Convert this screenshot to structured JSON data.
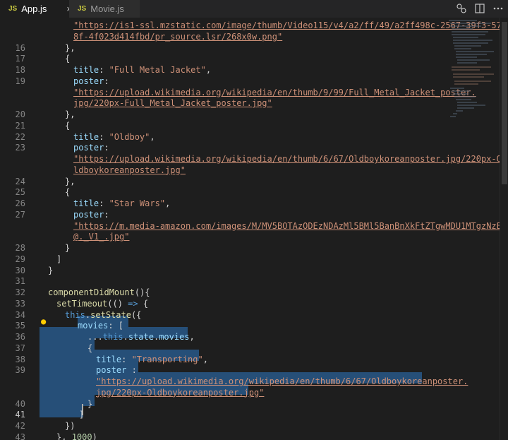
{
  "tabs": [
    {
      "icon": "JS",
      "label": "App.js",
      "close": "×"
    },
    {
      "icon": "JS",
      "label": "Movie.js"
    }
  ],
  "lines": [
    {
      "num": "",
      "segments": [
        {
          "t": "\"https://is1-ssl.mzstatic.com/image/thumb/Video115/v4/a2/ff/49/a2ff498c-2567-39f3-57",
          "c": "su"
        }
      ]
    },
    {
      "num": "",
      "segments": [
        {
          "t": "8f-4f023d414fbd/pr_source.lsr/268x0w.png\"",
          "c": "su"
        }
      ]
    },
    {
      "num": "16",
      "segments": [
        {
          "t": "},",
          "c": "p"
        }
      ]
    },
    {
      "num": "17",
      "segments": [
        {
          "t": "{",
          "c": "p"
        }
      ]
    },
    {
      "num": "18",
      "segments": [
        {
          "t": "title",
          "c": "pr"
        },
        {
          "t": ": ",
          "c": "p"
        },
        {
          "t": "\"Full Metal Jacket\"",
          "c": "s"
        },
        {
          "t": ",",
          "c": "p"
        }
      ]
    },
    {
      "num": "19",
      "segments": [
        {
          "t": "poster",
          "c": "pr"
        },
        {
          "t": ":",
          "c": "p"
        }
      ]
    },
    {
      "num": "",
      "segments": [
        {
          "t": "\"https://upload.wikimedia.org/wikipedia/en/thumb/9/99/Full_Metal_Jacket_poster.",
          "c": "su"
        }
      ]
    },
    {
      "num": "",
      "segments": [
        {
          "t": "jpg/220px-Full_Metal_Jacket_poster.jpg\"",
          "c": "su"
        }
      ]
    },
    {
      "num": "20",
      "segments": [
        {
          "t": "},",
          "c": "p"
        }
      ]
    },
    {
      "num": "21",
      "segments": [
        {
          "t": "{",
          "c": "p"
        }
      ]
    },
    {
      "num": "22",
      "segments": [
        {
          "t": "title",
          "c": "pr"
        },
        {
          "t": ": ",
          "c": "p"
        },
        {
          "t": "\"Oldboy\"",
          "c": "s"
        },
        {
          "t": ",",
          "c": "p"
        }
      ]
    },
    {
      "num": "23",
      "segments": [
        {
          "t": "poster",
          "c": "pr"
        },
        {
          "t": ":",
          "c": "p"
        }
      ]
    },
    {
      "num": "",
      "segments": [
        {
          "t": "\"https://upload.wikimedia.org/wikipedia/en/thumb/6/67/Oldboykoreanposter.jpg/220px-O",
          "c": "su"
        }
      ]
    },
    {
      "num": "",
      "segments": [
        {
          "t": "ldboykoreanposter.jpg\"",
          "c": "su"
        }
      ]
    },
    {
      "num": "24",
      "segments": [
        {
          "t": "},",
          "c": "p"
        }
      ]
    },
    {
      "num": "25",
      "segments": [
        {
          "t": "{",
          "c": "p"
        }
      ]
    },
    {
      "num": "26",
      "segments": [
        {
          "t": "title",
          "c": "pr"
        },
        {
          "t": ": ",
          "c": "p"
        },
        {
          "t": "\"Star Wars\"",
          "c": "s"
        },
        {
          "t": ",",
          "c": "p"
        }
      ]
    },
    {
      "num": "27",
      "segments": [
        {
          "t": "poster",
          "c": "pr"
        },
        {
          "t": ":",
          "c": "p"
        }
      ]
    },
    {
      "num": "",
      "segments": [
        {
          "t": "\"https://m.media-amazon.com/images/M/MV5BOTAzODEzNDAzMl5BMl5BanBnXkFtZTgwMDU1MTgzNzE",
          "c": "su"
        }
      ]
    },
    {
      "num": "",
      "segments": [
        {
          "t": "@._V1_.jpg\"",
          "c": "su"
        }
      ]
    },
    {
      "num": "28",
      "segments": [
        {
          "t": "}",
          "c": "p"
        }
      ]
    },
    {
      "num": "29",
      "segments": [
        {
          "t": "]",
          "c": "p"
        }
      ]
    },
    {
      "num": "30",
      "segments": [
        {
          "t": "}",
          "c": "p"
        }
      ]
    },
    {
      "num": "31",
      "segments": []
    },
    {
      "num": "32",
      "segments": [
        {
          "t": "componentDidMount",
          "c": "f"
        },
        {
          "t": "(){",
          "c": "p"
        }
      ]
    },
    {
      "num": "33",
      "segments": [
        {
          "t": "setTimeout",
          "c": "f"
        },
        {
          "t": "(() ",
          "c": "p"
        },
        {
          "t": "=>",
          "c": "k"
        },
        {
          "t": " {",
          "c": "p"
        }
      ]
    },
    {
      "num": "34",
      "segments": [
        {
          "t": "this",
          "c": "k"
        },
        {
          "t": ".",
          "c": "p"
        },
        {
          "t": "setState",
          "c": "f"
        },
        {
          "t": "({",
          "c": "p"
        }
      ]
    },
    {
      "num": "35",
      "segments": [
        {
          "t": "movies",
          "c": "pr"
        },
        {
          "t": ": [",
          "c": "p"
        }
      ]
    },
    {
      "num": "36",
      "segments": [
        {
          "t": "...",
          "c": "p"
        },
        {
          "t": "this",
          "c": "k"
        },
        {
          "t": ".",
          "c": "p"
        },
        {
          "t": "state",
          "c": "pr"
        },
        {
          "t": ".",
          "c": "p"
        },
        {
          "t": "movies",
          "c": "pr"
        },
        {
          "t": ",",
          "c": "p"
        }
      ]
    },
    {
      "num": "37",
      "segments": [
        {
          "t": "{",
          "c": "p"
        }
      ]
    },
    {
      "num": "38",
      "segments": [
        {
          "t": "title",
          "c": "pr"
        },
        {
          "t": ": ",
          "c": "p"
        },
        {
          "t": "\"Transporting\"",
          "c": "s"
        },
        {
          "t": ",",
          "c": "p"
        }
      ]
    },
    {
      "num": "39",
      "segments": [
        {
          "t": "poster",
          "c": "pr"
        },
        {
          "t": " :",
          "c": "p"
        }
      ]
    },
    {
      "num": "",
      "segments": [
        {
          "t": "\"https://upload.wikimedia.org/wikipedia/en/thumb/6/67/Oldboykoreanposter.",
          "c": "su"
        }
      ]
    },
    {
      "num": "",
      "segments": [
        {
          "t": "jpg/220px-Oldboykoreanposter.jpg\"",
          "c": "su"
        }
      ]
    },
    {
      "num": "40",
      "segments": [
        {
          "t": "}",
          "c": "p"
        }
      ]
    },
    {
      "num": "41",
      "segments": [
        {
          "t": "]",
          "c": "p"
        }
      ]
    },
    {
      "num": "42",
      "segments": [
        {
          "t": "})",
          "c": "p"
        }
      ]
    },
    {
      "num": "43",
      "segments": [
        {
          "t": "}, ",
          "c": "p"
        },
        {
          "t": "1000",
          "c": "n"
        },
        {
          "t": ")",
          "c": "p"
        }
      ]
    },
    {
      "num": "",
      "segments": [
        {
          "t": "}",
          "c": "p"
        }
      ]
    }
  ],
  "colors": {
    "background": "#1e1e1e",
    "selection": "#264f78",
    "string": "#ce9178",
    "keyword": "#569cd6",
    "property": "#9cdcfe",
    "function": "#dcdcaa",
    "number": "#b5cea8"
  }
}
